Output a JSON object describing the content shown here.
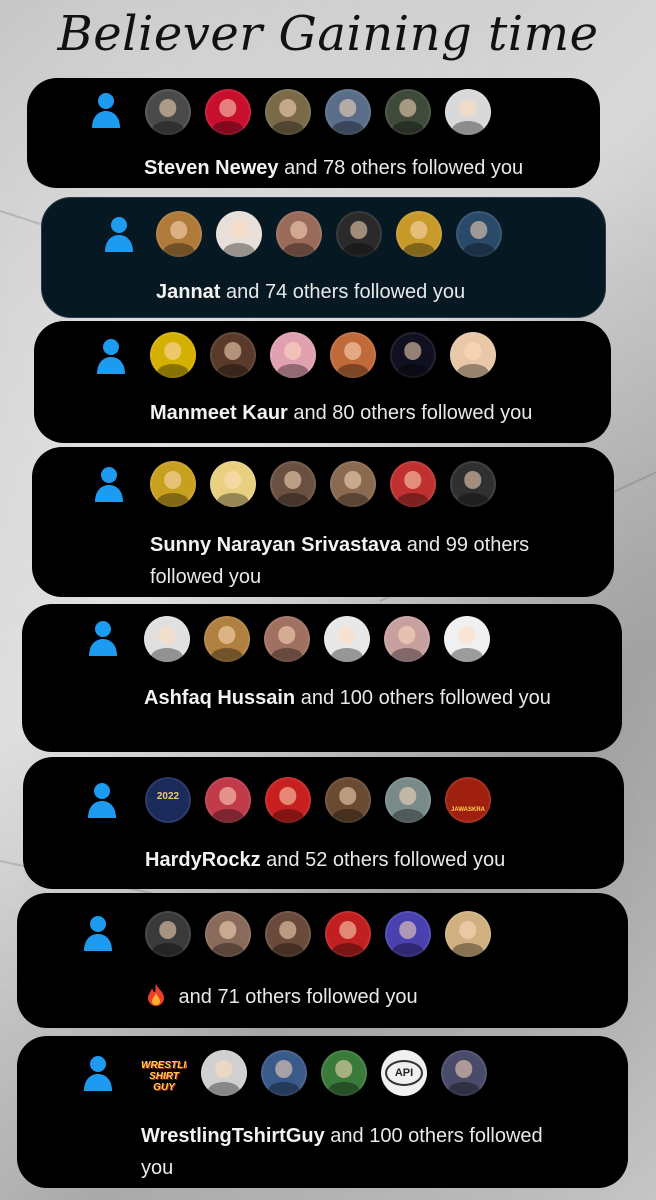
{
  "title": "Believer Gaining time",
  "colors": {
    "icon_blue": "#1d9bf0",
    "card_bg": "#000000",
    "card_bg_alt": "#061822"
  },
  "notifications": [
    {
      "name": "Steven Newey",
      "text": " and 78 others followed you",
      "avatars": [
        "#4a4a4a",
        "#c8102e",
        "#7a6a4a",
        "#5a6e8a",
        "#3e4a3a",
        "#d9d9d9"
      ]
    },
    {
      "name": "Jannat",
      "text": " and 74 others followed you",
      "avatars": [
        "#b07a3a",
        "#e8e0d8",
        "#9a6a5a",
        "#2a2a2a",
        "#c89a2a",
        "#2a4a6a"
      ]
    },
    {
      "name": "Manmeet Kaur",
      "text": " and 80 others followed you",
      "avatars": [
        "#d4b000",
        "#5a3a2a",
        "#e0a0b0",
        "#c06a3a",
        "#101020",
        "#e8c8a8"
      ]
    },
    {
      "name": "Sunny Narayan Srivastava",
      "text": " and 99 others followed you",
      "avatars": [
        "#c8a020",
        "#e8d080",
        "#6a5040",
        "#8a6a50",
        "#c03030",
        "#303030"
      ]
    },
    {
      "name": "Ashfaq Hussain",
      "text": " and 100 others followed you",
      "avatars": [
        "#e0e0e0",
        "#b08040",
        "#a07060",
        "#e8e8e8",
        "#c8a0a0",
        "#f0f0f0"
      ]
    },
    {
      "name": "HardyRockz",
      "text": " and 52 others followed you",
      "avatars": [
        "#1a2a5a",
        "#c03a4a",
        "#c82020",
        "#6a4a30",
        "#7a8a8a",
        "#a02010"
      ],
      "avatar_labels": [
        "2022",
        "",
        "",
        "",
        "",
        "JAWASKRA"
      ]
    },
    {
      "name": "",
      "fire_icon": "fire-icon",
      "text": " and 71 others followed you",
      "avatars": [
        "#3a3a3a",
        "#8a6a5a",
        "#6a4a3a",
        "#c02020",
        "#4a40b0",
        "#d0b080"
      ]
    },
    {
      "name": "WrestlingTshirtGuy",
      "text": " and 100 others followed you",
      "avatars": [
        "#000000",
        "#d0d0d0",
        "#3a5a8a",
        "#3a7a3a",
        "#f0f0f0",
        "#4a4a6a"
      ],
      "avatar_labels": [
        "WRESTLING SHIRT GUY",
        "",
        "",
        "",
        "API",
        ""
      ]
    }
  ]
}
